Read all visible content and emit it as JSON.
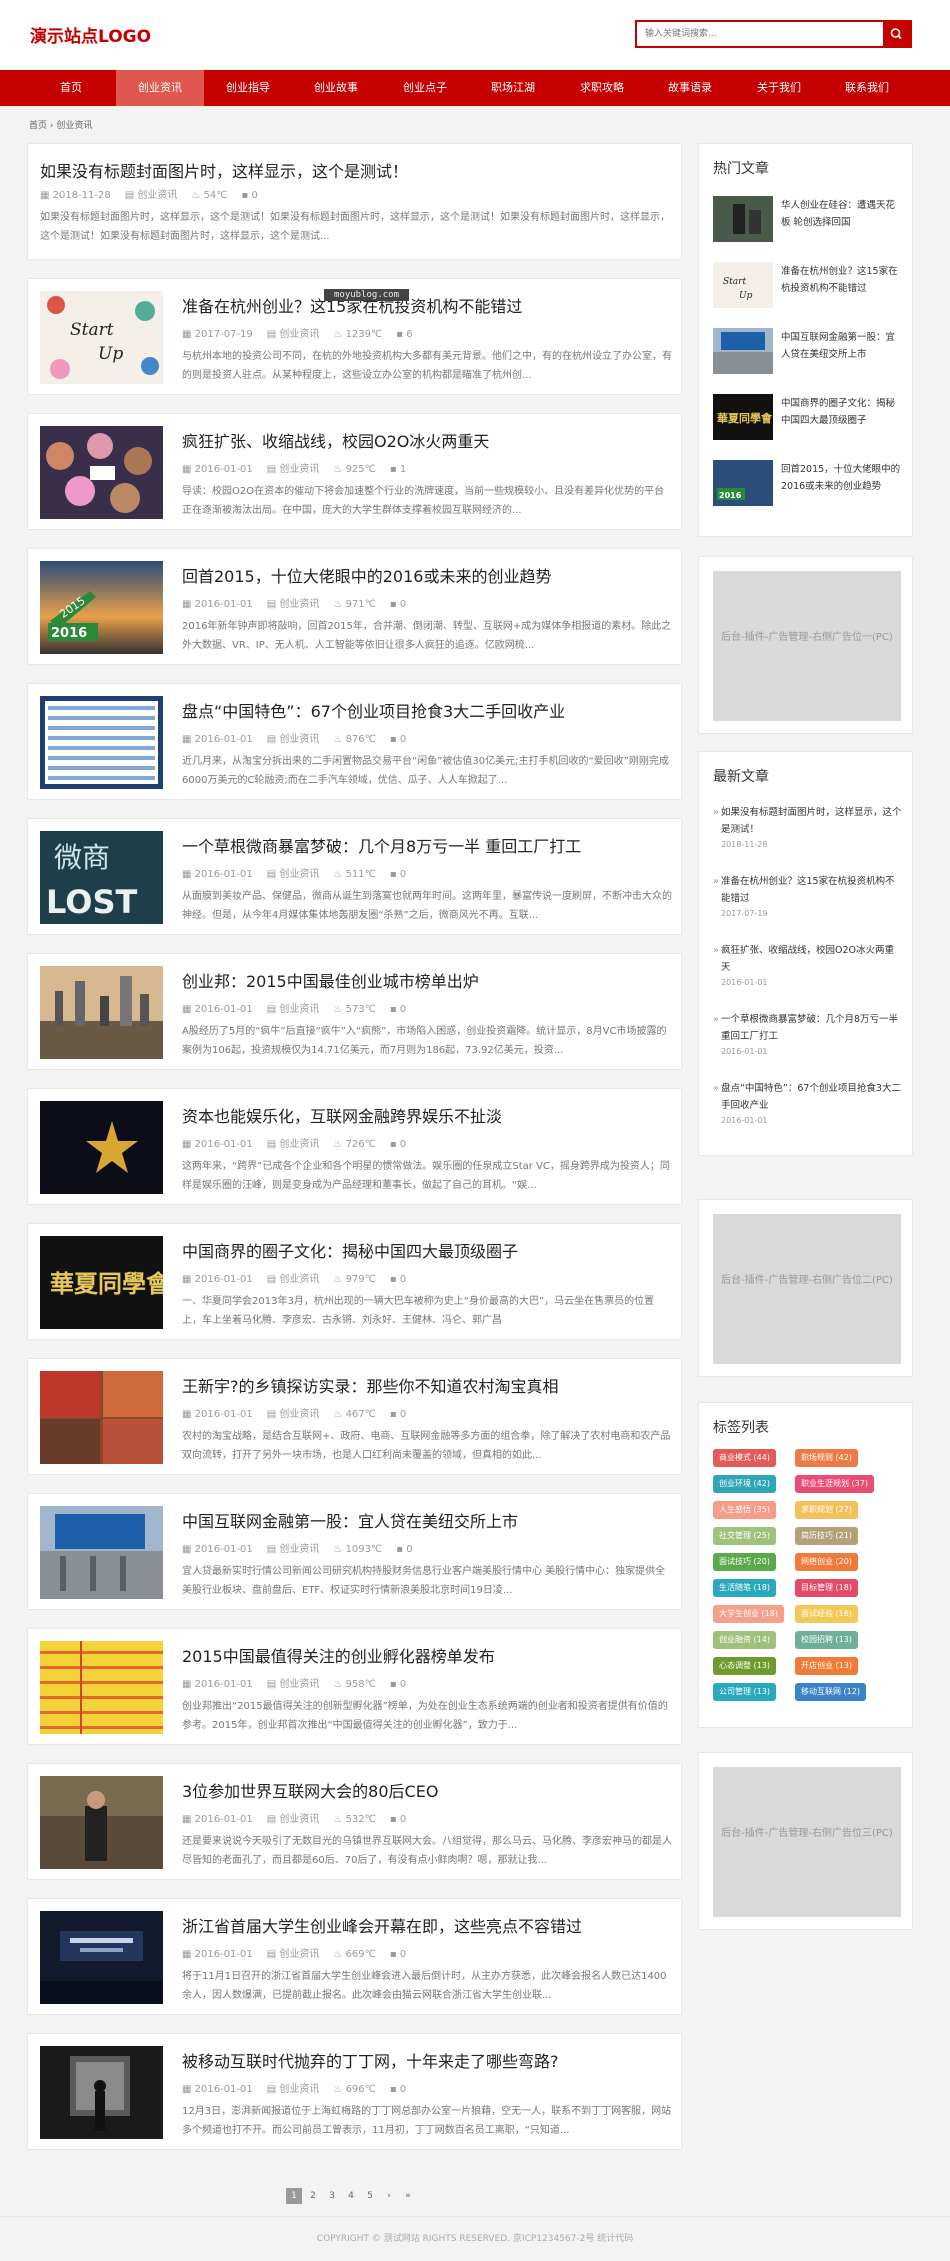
{
  "header": {
    "logo": "演示站点LOGO",
    "search_placeholder": "输入关键词搜索..."
  },
  "nav": [
    "首页",
    "创业资讯",
    "创业指导",
    "创业故事",
    "创业点子",
    "职场江湖",
    "求职攻略",
    "故事语录",
    "关于我们",
    "联系我们"
  ],
  "breadcrumb": "首页 › 创业资讯",
  "articles": [
    {
      "title": "如果没有标题封面图片时，这样显示，这个是测试！",
      "date": "2018-11-28",
      "cat": "创业资讯",
      "views": "54℃",
      "comments": "0",
      "desc": "如果没有标题封面图片时，这样显示，这个是测试！如果没有标题封面图片时，这样显示，这个是测试！如果没有标题封面图片时，这样显示，这个是测试！如果没有标题封面图片时，这样显示，这个是测试..."
    },
    {
      "title": "准备在杭州创业？这15家在杭投资机构不能错过",
      "date": "2017-07-19",
      "cat": "创业资讯",
      "views": "1239℃",
      "comments": "6",
      "desc": "与杭州本地的投资公司不同，在杭的外地投资机构大多都有美元背景。他们之中，有的在杭州设立了办公室，有的则是投资人驻点。从某种程度上，这些设立办公室的机构都是瞄准了杭州创..."
    },
    {
      "title": "疯狂扩张、收缩战线，校园O2O冰火两重天",
      "date": "2016-01-01",
      "cat": "创业资讯",
      "views": "925℃",
      "comments": "1",
      "desc": "导读：校园O2O在资本的催动下将会加速整个行业的洗牌速度，当前一些规模较小、且没有差异化优势的平台正在逐渐被淘汰出局。在中国，庞大的大学生群体支撑着校园互联网经济的..."
    },
    {
      "title": "回首2015，十位大佬眼中的2016或未来的创业趋势",
      "date": "2016-01-01",
      "cat": "创业资讯",
      "views": "971℃",
      "comments": "0",
      "desc": "2016年新年钟声即将敲响，回首2015年，合并潮、倒闭潮、转型、互联网+成为媒体争相报道的素材。除此之外大数据、VR、IP、无人机、人工智能等依旧让很多人疯狂的追逐。亿欧网梳..."
    },
    {
      "title": "盘点“中国特色”：67个创业项目抢食3大二手回收产业",
      "date": "2016-01-01",
      "cat": "创业资讯",
      "views": "876℃",
      "comments": "0",
      "desc": "近几月来，从淘宝分拆出来的二手闲置物品交易平台“闲鱼”被估值30亿美元;主打手机回收的“爱回收”刚刚完成6000万美元的C轮融资;而在二手汽车领域，优信、瓜子、人人车掀起了..."
    },
    {
      "title": "一个草根微商暴富梦破：几个月8万亏一半 重回工厂打工",
      "date": "2016-01-01",
      "cat": "创业资讯",
      "views": "511℃",
      "comments": "0",
      "desc": "从面膜到美妆产品、保健品，微商从诞生到落寞也就两年时间。这两年里，暴富传说一度刷屏，不断冲击大众的神经。但是，从今年4月媒体集体地轰朋友圈“杀熟”之后，微商风光不再。互联..."
    },
    {
      "title": "创业邦：2015中国最佳创业城市榜单出炉",
      "date": "2016-01-01",
      "cat": "创业资讯",
      "views": "573℃",
      "comments": "0",
      "desc": "A股经历了5月的“疯牛”后直接“疯牛”入“疯熊”，市场陷入困惑，创业投资霜降。统计显示，8月VC市场披露的案例为106起，投资规模仅为14.71亿美元，而7月则为186起，73.92亿美元，投资..."
    },
    {
      "title": "资本也能娱乐化，互联网金融跨界娱乐不扯淡",
      "date": "2016-01-01",
      "cat": "创业资讯",
      "views": "726℃",
      "comments": "0",
      "desc": "这两年来，“跨界”已成各个企业和各个明星的惯常做法。娱乐圈的任泉成立Star VC，摇身跨界成为投资人；同样是娱乐圈的汪峰，则是变身成为产品经理和董事长，做起了自己的耳机。“娱..."
    },
    {
      "title": "中国商界的圈子文化：揭秘中国四大最顶级圈子",
      "date": "2016-01-01",
      "cat": "创业资讯",
      "views": "979℃",
      "comments": "0",
      "desc": "一、华夏同学会2013年3月，杭州出现的一辆大巴车被称为史上“身价最高的大巴”，马云坐在售票员的位置上，车上坐着马化腾、李彦宏、古永锵、刘永好、王健林、冯仑、郭广昌"
    },
    {
      "title": "王新宇?的乡镇探访实录：那些你不知道农村淘宝真相",
      "date": "2016-01-01",
      "cat": "创业资讯",
      "views": "467℃",
      "comments": "0",
      "desc": "农村的淘宝战略，是结合互联网+、政府、电商、互联网金融等多方面的组合拳，除了解决了农村电商和农产品双向流转，打开了另外一块市场，也是人口红利尚未覆盖的领域，但真相的如此..."
    },
    {
      "title": "中国互联网金融第一股：宜人贷在美纽交所上市",
      "date": "2016-01-01",
      "cat": "创业资讯",
      "views": "1093℃",
      "comments": "0",
      "desc": "宜人贷最新实时行情公司新闻公司研究机构持股财务信息行业客户端美股行情中心 美股行情中心：独家提供全美股行业板块、盘前盘后、ETF、权证实时行情新浪美股北京时间19日凌..."
    },
    {
      "title": "2015中国最值得关注的创业孵化器榜单发布",
      "date": "2016-01-01",
      "cat": "创业资讯",
      "views": "958℃",
      "comments": "0",
      "desc": "创业邦推出“2015最值得关注的创新型孵化器”榜单，为处在创业生态系统两端的创业者和投资者提供有价值的参考。2015年，创业邦首次推出“中国最值得关注的创业孵化器”，致力于..."
    },
    {
      "title": "3位参加世界互联网大会的80后CEO",
      "date": "2016-01-01",
      "cat": "创业资讯",
      "views": "532℃",
      "comments": "0",
      "desc": "还是要来说说今天吸引了无数目光的乌镇世界互联网大会。八组觉得，那么马云、马化腾、李彦宏神马的都是人尽皆知的老面孔了，而且都是60后、70后了，有没有点小鲜肉啊？嗯，那就让我..."
    },
    {
      "title": "浙江省首届大学生创业峰会开幕在即，这些亮点不容错过",
      "date": "2016-01-01",
      "cat": "创业资讯",
      "views": "669℃",
      "comments": "0",
      "desc": "将于11月1日召开的浙江省首届大学生创业峰会进入最后倒计时，从主办方获悉，此次峰会报名人数已达1400余人，因人数爆满，已提前截止报名。此次峰会由猫云网联合浙江省大学生创业联..."
    },
    {
      "title": "被移动互联时代抛弃的丁丁网，十年来走了哪些弯路?",
      "date": "2016-01-01",
      "cat": "创业资讯",
      "views": "696℃",
      "comments": "0",
      "desc": "12月3日，澎湃新闻报道位于上海虹梅路的丁丁网总部办公室一片狼藉，空无一人，联系不到丁丁网客服，网站多个频道也打不开。而公司前员工曾表示，11月初，丁丁网数百名员工离职，“只知道..."
    }
  ],
  "watermark": "moyublog.com",
  "pager": [
    "1",
    "2",
    "3",
    "4",
    "5",
    "›",
    "»"
  ],
  "footer": "COPYRIGHT © 测试网站 RIGHTS RESERVED. 京ICP1234567-2号 统计代码",
  "sidebar": {
    "hot_title": "热门文章",
    "hot": [
      "华人创业在硅谷：遭遇天花板 轮创选择回国",
      "准备在杭州创业？这15家在杭投资机构不能错过",
      "中国互联网金融第一股：宜人贷在美纽交所上市",
      "中国商界的圈子文化：揭秘中国四大最顶级圈子",
      "回首2015，十位大佬眼中的2016或未来的创业趋势"
    ],
    "ad1": "后台-插件-广告管理-右侧广告位一(PC)",
    "new_title": "最新文章",
    "new": [
      {
        "t": "如果没有标题封面图片时，这样显示，这个是测试！",
        "d": "2018-11-28"
      },
      {
        "t": "准备在杭州创业？这15家在杭投资机构不能错过",
        "d": "2017-07-19"
      },
      {
        "t": "疯狂扩张、收缩战线，校园O2O冰火两重天",
        "d": "2016-01-01"
      },
      {
        "t": "一个草根微商暴富梦破：几个月8万亏一半 重回工厂打工",
        "d": "2016-01-01"
      },
      {
        "t": "盘点“中国特色”：67个创业项目抢食3大二手回收产业",
        "d": "2016-01-01"
      }
    ],
    "ad2": "后台-插件-广告管理-右侧广告位二(PC)",
    "tags_title": "标签列表",
    "tags": [
      {
        "t": "商业模式 (44)",
        "c": "#e15b5b"
      },
      {
        "t": "职场规则 (42)",
        "c": "#ee7a45"
      },
      {
        "t": "创业环境 (42)",
        "c": "#2fa6b6"
      },
      {
        "t": "职业生涯规划 (37)",
        "c": "#ea4d74"
      },
      {
        "t": "人生感悟 (35)",
        "c": "#f59d8a"
      },
      {
        "t": "求职规划 (27)",
        "c": "#f3c15c"
      },
      {
        "t": "社交管理 (25)",
        "c": "#9fc37e"
      },
      {
        "t": "简历技巧 (21)",
        "c": "#b1a27a"
      },
      {
        "t": "面试技巧 (20)",
        "c": "#5ba94c"
      },
      {
        "t": "网络创业 (20)",
        "c": "#ef7a3b"
      },
      {
        "t": "生活随笔 (18)",
        "c": "#29a9b9"
      },
      {
        "t": "目标管理 (18)",
        "c": "#e64a6a"
      },
      {
        "t": "大学生创业 (18)",
        "c": "#f5a08e"
      },
      {
        "t": "面试经验 (16)",
        "c": "#f4c857"
      },
      {
        "t": "创业融资 (14)",
        "c": "#9ec17b"
      },
      {
        "t": "校园招聘 (13)",
        "c": "#6eaf9a"
      },
      {
        "t": "心态调整 (13)",
        "c": "#6d9b2e"
      },
      {
        "t": "开店创业 (13)",
        "c": "#f17a37"
      },
      {
        "t": "公司管理 (13)",
        "c": "#29a9b9"
      },
      {
        "t": "移动互联网 (12)",
        "c": "#3b83c8"
      }
    ],
    "ad3": "后台-插件-广告管理-右侧广告位三(PC)"
  }
}
